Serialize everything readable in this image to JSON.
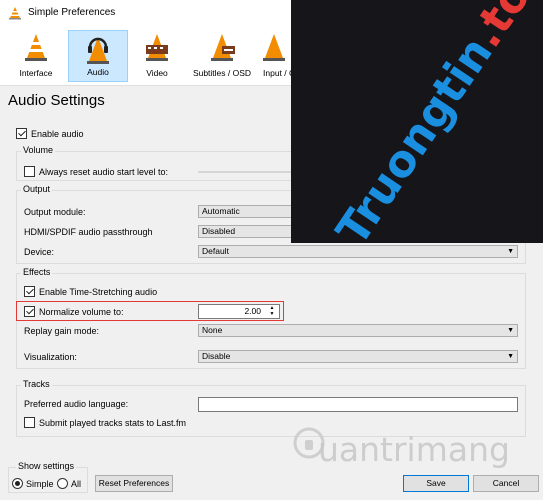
{
  "window": {
    "title": "Simple Preferences"
  },
  "toolbar": {
    "items": [
      {
        "label": "Interface"
      },
      {
        "label": "Audio"
      },
      {
        "label": "Video"
      },
      {
        "label": "Subtitles / OSD"
      },
      {
        "label": "Input / C"
      }
    ]
  },
  "page": {
    "heading": "Audio Settings"
  },
  "enable_audio": {
    "label": "Enable audio",
    "checked": true
  },
  "volume": {
    "title": "Volume",
    "reset_label": "Always reset audio start level to:",
    "reset_checked": false
  },
  "output": {
    "title": "Output",
    "module_label": "Output module:",
    "module_value": "Automatic",
    "hdmi_label": "HDMI/SPDIF audio passthrough",
    "hdmi_value": "Disabled",
    "device_label": "Device:",
    "device_value": "Default"
  },
  "effects": {
    "title": "Effects",
    "stretch_label": "Enable Time-Stretching audio",
    "stretch_checked": true,
    "normalize_label": "Normalize volume to:",
    "normalize_checked": true,
    "normalize_value": "2.00",
    "replay_label": "Replay gain mode:",
    "replay_value": "None",
    "vis_label": "Visualization:",
    "vis_value": "Disable"
  },
  "tracks": {
    "title": "Tracks",
    "lang_label": "Preferred audio language:",
    "lang_value": "",
    "lastfm_label": "Submit played tracks stats to Last.fm",
    "lastfm_checked": false
  },
  "footer": {
    "show_settings": "Show settings",
    "simple": "Simple",
    "all": "All",
    "reset": "Reset Preferences",
    "save": "Save",
    "cancel": "Cancel"
  },
  "watermark": {
    "text_main": "Truongtin",
    "text_dot": ".top",
    "text_second": "uantrimang"
  },
  "colors": {
    "accent": "#0078d7",
    "highlight": "#e53935",
    "selected_tab": "#cce8ff"
  }
}
